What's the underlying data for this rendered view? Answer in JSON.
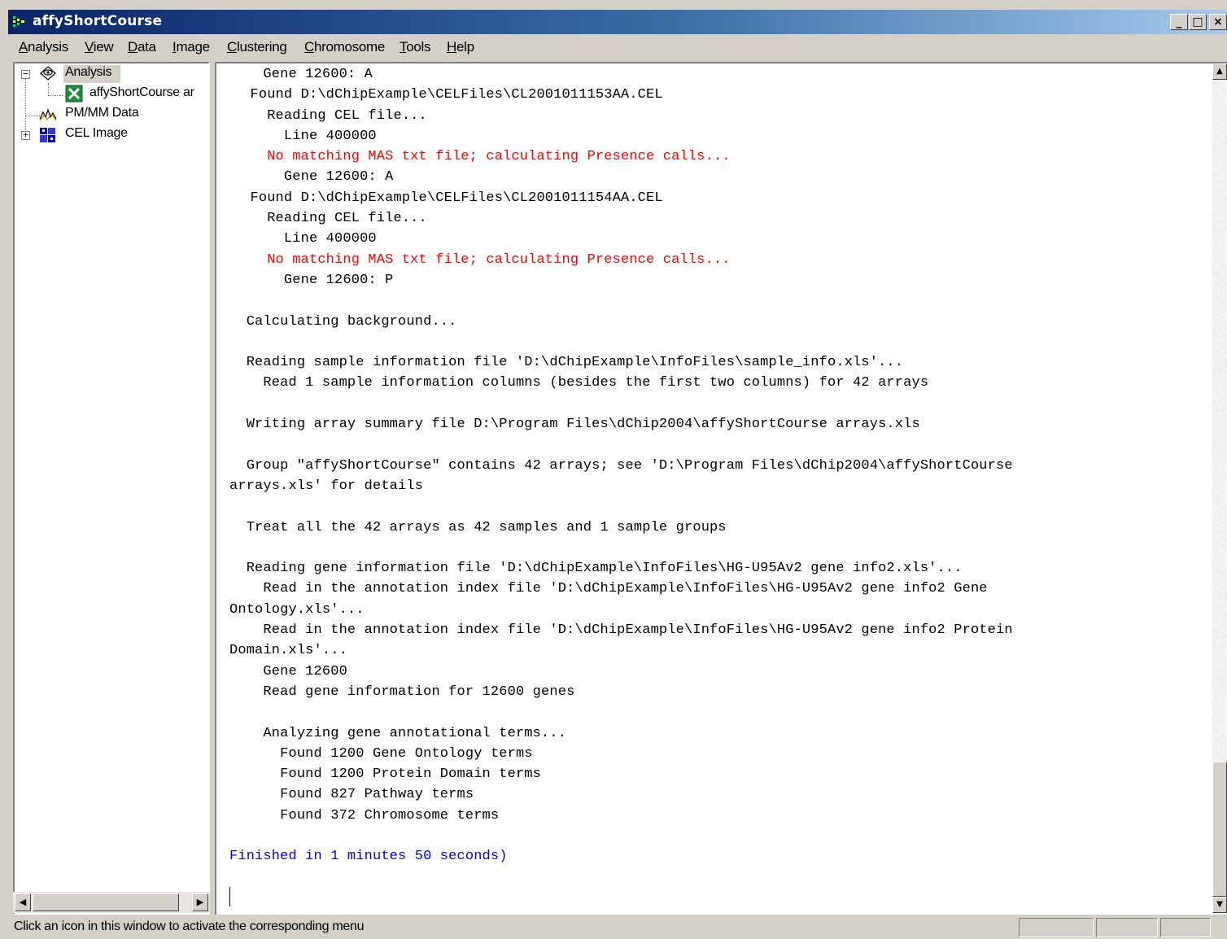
{
  "window": {
    "title": "affyShortCourse",
    "buttons": {
      "minimize": "_",
      "maximize": "□",
      "close": "×"
    }
  },
  "menu": [
    "Analysis",
    "View",
    "Data",
    "Image",
    "Clustering",
    "Chromosome",
    "Tools",
    "Help"
  ],
  "tree": {
    "items": [
      {
        "label": "Analysis",
        "icon": "analysis-icon",
        "expander": "−",
        "selected": true
      },
      {
        "label": "affyShortCourse ar",
        "icon": "excel-icon"
      },
      {
        "label": "PM/MM Data",
        "icon": "pmmm-chart-icon"
      },
      {
        "label": "CEL Image",
        "icon": "cel-image-icon",
        "expander": "+"
      }
    ]
  },
  "log": [
    {
      "text": "    Gene 12600: A",
      "color": "black"
    },
    {
      "text": "Found D:\\dChipExample\\CELFiles\\CL2001011153AA.CEL",
      "indent": 1,
      "color": "black"
    },
    {
      "text": "  Reading CEL file...",
      "indent": 1,
      "color": "black"
    },
    {
      "text": "    Line 400000",
      "indent": 1,
      "color": "black"
    },
    {
      "text": "  No matching MAS txt file; calculating Presence calls...",
      "indent": 1,
      "color": "red"
    },
    {
      "text": "    Gene 12600: A",
      "indent": 1,
      "color": "black"
    },
    {
      "text": "Found D:\\dChipExample\\CELFiles\\CL2001011154AA.CEL",
      "indent": 1,
      "color": "black"
    },
    {
      "text": "  Reading CEL file...",
      "indent": 1,
      "color": "black"
    },
    {
      "text": "    Line 400000",
      "indent": 1,
      "color": "black"
    },
    {
      "text": "  No matching MAS txt file; calculating Presence calls...",
      "indent": 1,
      "color": "red"
    },
    {
      "text": "    Gene 12600: P",
      "indent": 1,
      "color": "black"
    },
    {
      "text": "",
      "color": "black"
    },
    {
      "text": "  Calculating background...",
      "color": "black"
    },
    {
      "text": "",
      "color": "black"
    },
    {
      "text": "  Reading sample information file 'D:\\dChipExample\\InfoFiles\\sample_info.xls'...",
      "color": "black"
    },
    {
      "text": "    Read 1 sample information columns (besides the first two columns) for 42 arrays",
      "color": "black"
    },
    {
      "text": "",
      "color": "black"
    },
    {
      "text": "  Writing array summary file D:\\Program Files\\dChip2004\\affyShortCourse arrays.xls",
      "color": "black"
    },
    {
      "text": "",
      "color": "black"
    },
    {
      "text": "  Group \"affyShortCourse\" contains 42 arrays; see 'D:\\Program Files\\dChip2004\\affyShortCourse",
      "color": "black"
    },
    {
      "text": "arrays.xls' for details",
      "color": "black"
    },
    {
      "text": "",
      "color": "black"
    },
    {
      "text": "  Treat all the 42 arrays as 42 samples and 1 sample groups",
      "color": "black"
    },
    {
      "text": "",
      "color": "black"
    },
    {
      "text": "  Reading gene information file 'D:\\dChipExample\\InfoFiles\\HG-U95Av2 gene info2.xls'...",
      "color": "black"
    },
    {
      "text": "    Read in the annotation index file 'D:\\dChipExample\\InfoFiles\\HG-U95Av2 gene info2 Gene",
      "color": "black"
    },
    {
      "text": "Ontology.xls'...",
      "color": "black"
    },
    {
      "text": "    Read in the annotation index file 'D:\\dChipExample\\InfoFiles\\HG-U95Av2 gene info2 Protein",
      "color": "black"
    },
    {
      "text": "Domain.xls'...",
      "color": "black"
    },
    {
      "text": "    Gene 12600",
      "color": "black"
    },
    {
      "text": "    Read gene information for 12600 genes",
      "color": "black"
    },
    {
      "text": "",
      "color": "black"
    },
    {
      "text": "    Analyzing gene annotational terms...",
      "color": "black"
    },
    {
      "text": "      Found 1200 Gene Ontology terms",
      "color": "black"
    },
    {
      "text": "      Found 1200 Protein Domain terms",
      "color": "black"
    },
    {
      "text": "      Found 827 Pathway terms",
      "color": "black"
    },
    {
      "text": "      Found 372 Chromosome terms",
      "color": "black"
    },
    {
      "text": "",
      "color": "black"
    },
    {
      "text": "Finished in 1 minutes 50 seconds)",
      "color": "blue"
    }
  ],
  "status": {
    "text": "Click an icon in this window to activate the corresponding menu"
  },
  "colors": {
    "error_red": "#ff0000",
    "info_blue": "#0000ff",
    "title_dark": "#0a246a",
    "title_light": "#a6caf0",
    "chrome": "#d4d0c8"
  }
}
